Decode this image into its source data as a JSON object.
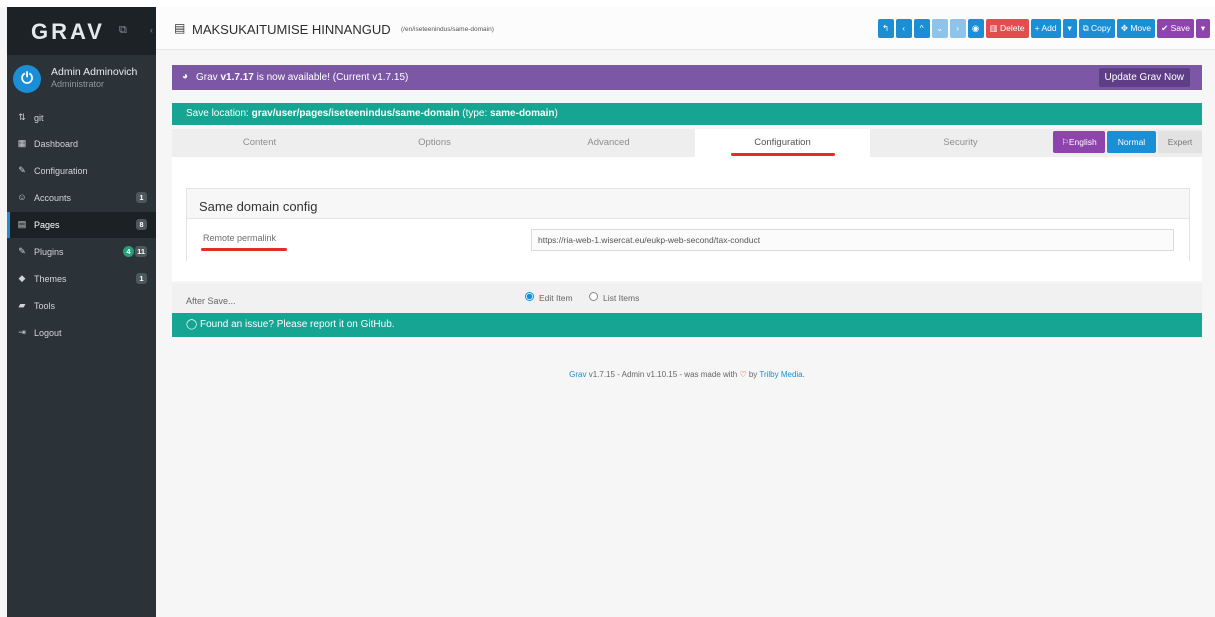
{
  "sidebar": {
    "logo": "GRAV",
    "user": {
      "name": "Admin Adminovich",
      "role": "Administrator",
      "avatar_glyph": "⏻"
    },
    "items": [
      {
        "label": "git",
        "icon": "⇅",
        "badge": ""
      },
      {
        "label": "Dashboard",
        "icon": "▦",
        "badge": ""
      },
      {
        "label": "Configuration",
        "icon": "✎",
        "badge": ""
      },
      {
        "label": "Accounts",
        "icon": "☺",
        "badge": "1"
      },
      {
        "label": "Pages",
        "icon": "▤",
        "badge": "8"
      },
      {
        "label": "Plugins",
        "icon": "✎",
        "badge": "11",
        "badge_update": "4"
      },
      {
        "label": "Themes",
        "icon": "◆",
        "badge": "1"
      },
      {
        "label": "Tools",
        "icon": "▰",
        "badge": ""
      },
      {
        "label": "Logout",
        "icon": "⇥",
        "badge": ""
      }
    ]
  },
  "header": {
    "title": "MAKSUKAITUMISE HINNANGUD",
    "route": "(/en/iseteenindus/same-domain)",
    "toolbar": {
      "delete": "Delete",
      "add": "Add",
      "copy": "Copy",
      "move": "Move",
      "save": "Save"
    }
  },
  "notice": {
    "prefix": "Grav ",
    "version": "v1.7.17",
    "suffix": " is now available! (Current v1.7.15)",
    "button": "Update Grav Now"
  },
  "save_location": {
    "prefix": "Save location: ",
    "path": "grav/user/pages/iseteenindus/same-domain",
    "type_prefix": " (type: ",
    "type": "same-domain",
    "type_suffix": ")"
  },
  "tabs": [
    "Content",
    "Options",
    "Advanced",
    "Configuration",
    "Security"
  ],
  "language": "English",
  "modes": {
    "normal": "Normal",
    "expert": "Expert"
  },
  "config": {
    "title": "Same domain config",
    "field_label": "Remote permalink",
    "field_value": "https://ria-web-1.wisercat.eu/eukp-web-second/tax-conduct"
  },
  "after_save": {
    "label": "After Save...",
    "option_edit": "Edit Item",
    "option_list": "List Items"
  },
  "github": "Found an issue? Please report it on GitHub.",
  "footer": {
    "grav": "Grav",
    "text": " v1.7.15 - Admin v1.10.15 - was made with ",
    "by": " by ",
    "author": "Trilby Media",
    "end": "."
  },
  "colors": {
    "sidebar": "#2b3339",
    "accent_blue": "#1a8fd6",
    "teal": "#16a593",
    "purple": "#7c57a6",
    "red": "#e52c22"
  }
}
